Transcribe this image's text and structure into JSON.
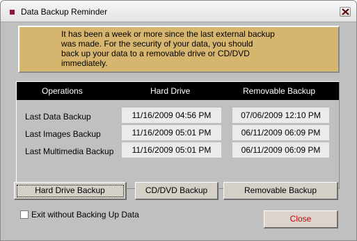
{
  "window": {
    "title": "Data Backup Reminder"
  },
  "message": {
    "text": "It has been a week or more since the last external backup\nwas made.  For the security of your data, you should\nback up your data to a removable drive or CD/DVD\nimmediately."
  },
  "table": {
    "headers": [
      "Operations",
      "Hard Drive",
      "Removable Backup"
    ],
    "rows": [
      {
        "label": "Last Data Backup",
        "hard_drive": "11/16/2009 04:56 PM",
        "removable": "07/06/2009 12:10 PM"
      },
      {
        "label": "Last Images Backup",
        "hard_drive": "11/16/2009 05:01 PM",
        "removable": "06/11/2009 06:09 PM"
      },
      {
        "label": "Last Multimedia Backup",
        "hard_drive": "11/16/2009 05:01 PM",
        "removable": "06/11/2009 06:09 PM"
      }
    ]
  },
  "buttons": {
    "hard_drive_backup": "Hard Drive Backup",
    "cd_dvd_backup": "CD/DVD Backup",
    "removable_backup": "Removable Backup",
    "close": "Close"
  },
  "options": {
    "exit_without_backup_label": "Exit without Backing Up Data",
    "exit_without_backup_checked": false
  },
  "colors": {
    "message_background": "#d6b56f",
    "header_background": "#000000",
    "close_text": "#cc0000",
    "app_icon": "#8b1a3a"
  },
  "icons": {
    "app": "app-icon",
    "window_close": "close-icon"
  }
}
